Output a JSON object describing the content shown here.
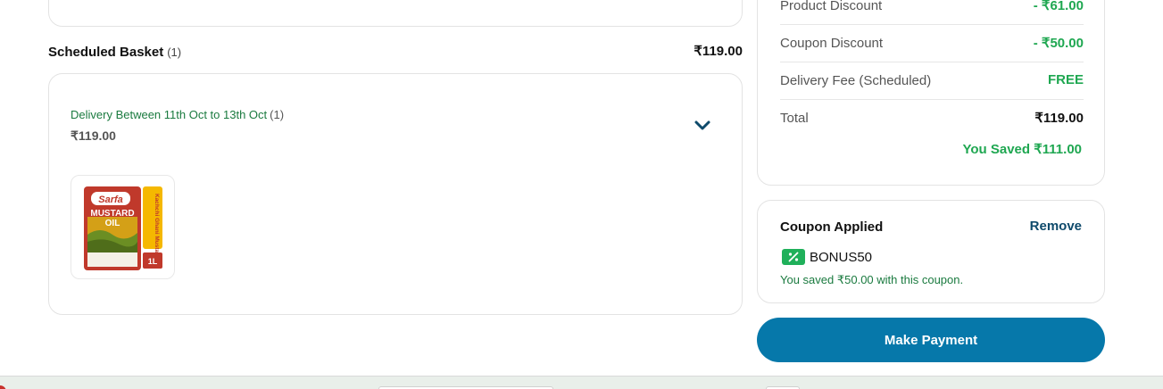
{
  "summary": {
    "rows": [
      {
        "label": "Product Discount",
        "value": "- ₹61.00"
      },
      {
        "label": "Coupon Discount",
        "value": "- ₹50.00"
      },
      {
        "label": "Delivery Fee (Scheduled)",
        "value": "FREE"
      },
      {
        "label": "Total",
        "value": "₹119.00"
      }
    ],
    "saved": "You Saved ₹111.00"
  },
  "basket": {
    "title": "Scheduled Basket",
    "count": "(1)",
    "total": "₹119.00",
    "delivery": {
      "label": "Delivery Between 11th Oct to 13th Oct",
      "count": "(1)",
      "price": "₹119.00"
    },
    "product": {
      "brand": "Sarfa",
      "name_line1": "MUSTARD",
      "name_line2": "OIL",
      "side_text": "Kachchi Ghani Mustard oil",
      "size": "1L"
    }
  },
  "coupon": {
    "title": "Coupon Applied",
    "remove_label": "Remove",
    "code": "BONUS50",
    "message": "You saved ₹50.00 with this coupon."
  },
  "actions": {
    "pay_label": "Make Payment"
  },
  "colors": {
    "accent": "#0678aa",
    "green": "#1fa751",
    "dark_green": "#1a7a3f",
    "link": "#0e4a6b"
  }
}
